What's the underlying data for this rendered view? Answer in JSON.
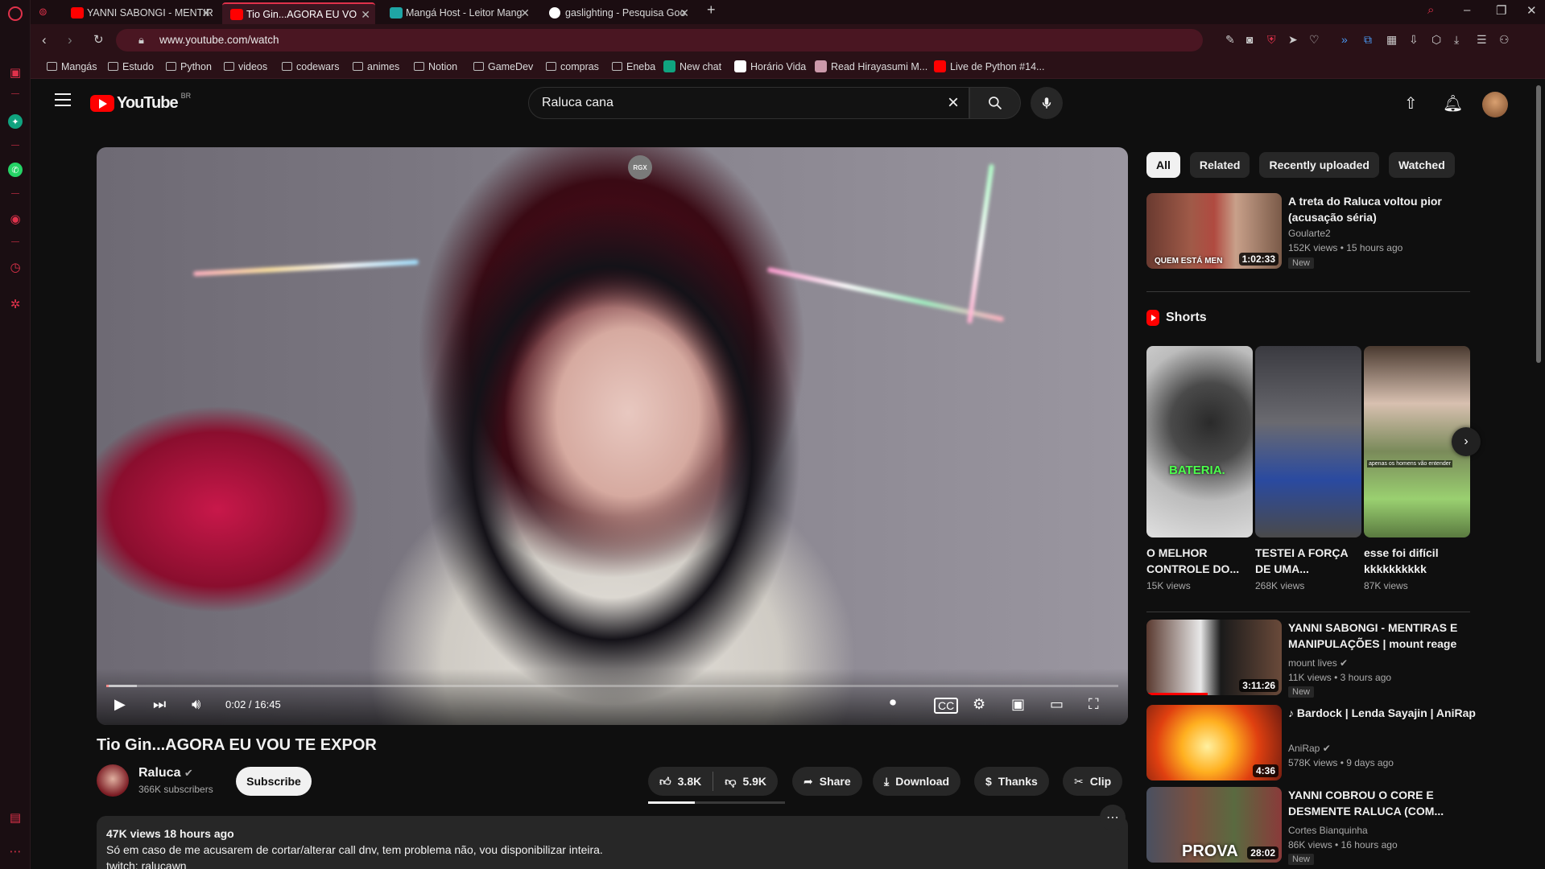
{
  "browser": {
    "tabs": [
      {
        "title": "YANNI SABONGI - MENTIR",
        "active": false
      },
      {
        "title": "Tio Gin...AGORA EU VO",
        "active": true
      },
      {
        "title": "Mangá Host - Leitor Mang",
        "active": false
      },
      {
        "title": "gaslighting - Pesquisa Goo",
        "active": false
      }
    ],
    "url": "www.youtube.com/watch",
    "bookmarks": [
      "Mangás",
      "Estudo",
      "Python",
      "videos",
      "codewars",
      "animes",
      "Notion",
      "GameDev",
      "compras",
      "Eneba",
      "New chat",
      "Horário Vida",
      "Read Hirayasumi M...",
      "Live de Python #14..."
    ]
  },
  "youtube": {
    "logo_text": "YouTube",
    "country_code": "BR",
    "search_query": "Raluca cana"
  },
  "player": {
    "overlay_badge": "RGX",
    "current_time": "0:02 / 16:45",
    "progress": 0.002
  },
  "video": {
    "title": "Tio Gin...AGORA EU VOU TE EXPOR",
    "channel": "Raluca",
    "subscribers": "366K subscribers",
    "subscribe_label": "Subscribe",
    "likes": "3.8K",
    "dislikes": "5.9K",
    "like_ratio": 0.34,
    "share_label": "Share",
    "download_label": "Download",
    "thanks_label": "Thanks",
    "clip_label": "Clip",
    "views_date": "47K views  18 hours ago",
    "description_line1": "Só em caso de me acusarem de cortar/alterar call dnv, tem problema não, vou disponibilizar inteira.",
    "description_line2": "twitch: ralucawn"
  },
  "sidebar": {
    "chips": [
      "All",
      "Related",
      "Recently uploaded",
      "Watched"
    ],
    "rec_top": {
      "title": "A treta do Raluca voltou pior (acusação séria)",
      "channel": "Goularte2",
      "views": "152K views  •  15 hours ago",
      "badge": "New",
      "duration": "1:02:33",
      "thumb_text": "QUEM ESTÁ MEN"
    },
    "shorts_title": "Shorts",
    "shorts": [
      {
        "title": "O MELHOR CONTROLE DO...",
        "views": "15K views",
        "overlay": "BATERIA."
      },
      {
        "title": "TESTEI A FORÇA DE UMA...",
        "views": "268K views",
        "overlay": ""
      },
      {
        "title": "esse foi difícil kkkkkkkkkk",
        "views": "87K views",
        "overlay": "apenas os homens vão entender"
      }
    ],
    "recs": [
      {
        "title": "YANNI SABONGI - MENTIRAS E MANIPULAÇÕES | mount reage",
        "channel": "mount lives",
        "views": "11K views  •  3 hours ago",
        "badge": "New",
        "duration": "3:11:26"
      },
      {
        "title": "♪ Bardock | Lenda Sayajin | AniRap",
        "channel": "AniRap",
        "views": "578K views  •  9 days ago",
        "badge": "",
        "duration": "4:36"
      },
      {
        "title": "YANNI COBROU O CORE E DESMENTE RALUCA (COM...",
        "channel": "Cortes Bianquinha",
        "views": "86K views  •  16 hours ago",
        "badge": "New",
        "duration": "28:02",
        "thumb_text": "PROVA"
      }
    ]
  },
  "colors": {
    "brand_red": "#ff0000",
    "opera_red": "#e0324b",
    "bg": "#0f0f0f"
  }
}
